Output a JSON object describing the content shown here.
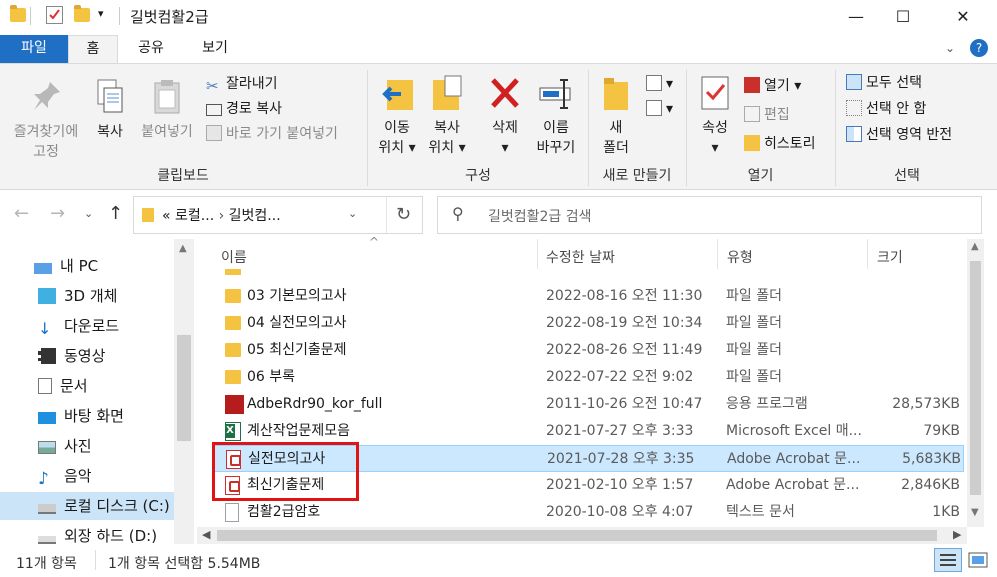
{
  "window": {
    "title": "길벗컴활2급",
    "min": "—",
    "max": "☐",
    "close": "✕"
  },
  "tabs": {
    "file": "파일",
    "home": "홈",
    "share": "공유",
    "view": "보기"
  },
  "ribbon": {
    "clipboard": {
      "label": "클립보드",
      "pin_line1": "즐겨찾기에",
      "pin_line2": "고정",
      "copy": "복사",
      "paste": "붙여넣기",
      "cut": "잘라내기",
      "copy_path": "경로 복사",
      "paste_shortcut": "바로 가기 붙여넣기"
    },
    "organize": {
      "label": "구성",
      "move_line1": "이동",
      "move_line2": "위치",
      "copyto_line1": "복사",
      "copyto_line2": "위치",
      "delete": "삭제",
      "rename_line1": "이름",
      "rename_line2": "바꾸기"
    },
    "new": {
      "label": "새로 만들기",
      "folder_line1": "새",
      "folder_line2": "폴더"
    },
    "open": {
      "label": "열기",
      "properties": "속성",
      "open": "열기",
      "edit": "편집",
      "history": "히스토리"
    },
    "select": {
      "label": "선택",
      "select_all": "모두 선택",
      "select_none": "선택 안 함",
      "invert": "선택 영역 반전"
    }
  },
  "address": {
    "prefix": "«",
    "crumb1": "로컬...",
    "crumb2": "길벗컴..."
  },
  "search": {
    "placeholder": "길벗컴활2급 검색"
  },
  "nav_pane": {
    "items": [
      {
        "label": "내 PC"
      },
      {
        "label": "3D 개체"
      },
      {
        "label": "다운로드"
      },
      {
        "label": "동영상"
      },
      {
        "label": "문서"
      },
      {
        "label": "바탕 화면"
      },
      {
        "label": "사진"
      },
      {
        "label": "음악"
      },
      {
        "label": "로컬 디스크 (C:)"
      },
      {
        "label": "외장 하드 (D:)"
      }
    ]
  },
  "columns": {
    "name": "이름",
    "date": "수정한 날짜",
    "type": "유형",
    "size": "크기"
  },
  "files": [
    {
      "name": "03 기본모의고사",
      "date": "2022-08-16 오전 11:30",
      "type": "파일 폴더",
      "size": "",
      "icon": "folder-icon"
    },
    {
      "name": "04 실전모의고사",
      "date": "2022-08-19 오전 10:34",
      "type": "파일 폴더",
      "size": "",
      "icon": "folder-icon"
    },
    {
      "name": "05 최신기출문제",
      "date": "2022-08-26 오전 11:49",
      "type": "파일 폴더",
      "size": "",
      "icon": "folder-icon"
    },
    {
      "name": "06 부록",
      "date": "2022-07-22 오전 9:02",
      "type": "파일 폴더",
      "size": "",
      "icon": "folder-icon"
    },
    {
      "name": "AdbeRdr90_kor_full",
      "date": "2011-10-26 오전 10:47",
      "type": "응용 프로그램",
      "size": "28,573KB",
      "icon": "installer-icon"
    },
    {
      "name": "계산작업문제모음",
      "date": "2021-07-27 오후 3:33",
      "type": "Microsoft Excel 매...",
      "size": "79KB",
      "icon": "excel-icon"
    },
    {
      "name": "실전모의고사",
      "date": "2021-07-28 오후 3:35",
      "type": "Adobe Acrobat 문...",
      "size": "5,683KB",
      "icon": "pdf-icon"
    },
    {
      "name": "최신기출문제",
      "date": "2021-02-10 오후 1:57",
      "type": "Adobe Acrobat 문...",
      "size": "2,846KB",
      "icon": "pdf-icon"
    },
    {
      "name": "컴활2급암호",
      "date": "2020-10-08 오후 4:07",
      "type": "텍스트 문서",
      "size": "1KB",
      "icon": "text-file-icon"
    }
  ],
  "status": {
    "count": "11개 항목",
    "selection": "1개 항목 선택함 5.54MB"
  }
}
